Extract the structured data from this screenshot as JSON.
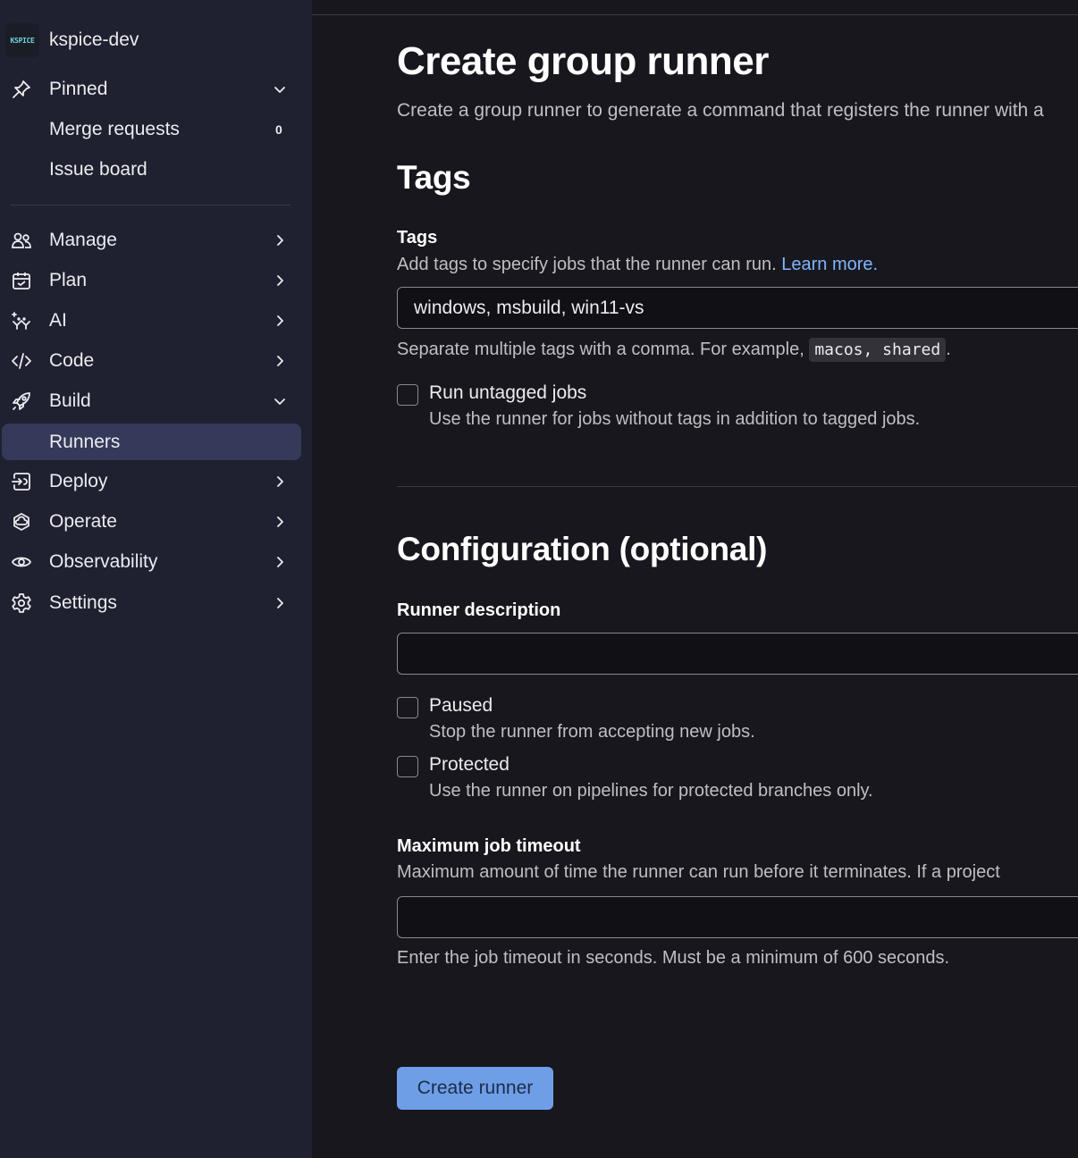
{
  "sidebar": {
    "group": {
      "avatar_text": "KSPICE",
      "name": "kspice-dev"
    },
    "pinned": {
      "label": "Pinned",
      "items": [
        {
          "label": "Merge requests",
          "count": "0"
        },
        {
          "label": "Issue board"
        }
      ]
    },
    "nav": [
      {
        "label": "Manage",
        "icon": "users-icon"
      },
      {
        "label": "Plan",
        "icon": "calendar-icon"
      },
      {
        "label": "AI",
        "icon": "sparkle-icon"
      },
      {
        "label": "Code",
        "icon": "code-icon"
      },
      {
        "label": "Build",
        "icon": "rocket-icon",
        "expanded": true,
        "children": [
          {
            "label": "Runners",
            "active": true
          }
        ]
      },
      {
        "label": "Deploy",
        "icon": "deploy-icon"
      },
      {
        "label": "Operate",
        "icon": "cloud-icon"
      },
      {
        "label": "Observability",
        "icon": "eye-icon"
      },
      {
        "label": "Settings",
        "icon": "gear-icon"
      }
    ]
  },
  "main": {
    "title": "Create group runner",
    "lead": "Create a group runner to generate a command that registers the runner with a",
    "tags_section": {
      "heading": "Tags",
      "label": "Tags",
      "description": "Add tags to specify jobs that the runner can run.",
      "learn_more": "Learn more.",
      "value": "windows, msbuild, win11-vs",
      "help_prefix": "Separate multiple tags with a comma. For example,",
      "help_code": "macos, shared",
      "help_suffix": ".",
      "untagged": {
        "label": "Run untagged jobs",
        "help": "Use the runner for jobs without tags in addition to tagged jobs.",
        "checked": false
      }
    },
    "config_section": {
      "heading": "Configuration (optional)",
      "description_label": "Runner description",
      "description_value": "",
      "paused": {
        "label": "Paused",
        "help": "Stop the runner from accepting new jobs.",
        "checked": false
      },
      "protected": {
        "label": "Protected",
        "help": "Use the runner on pipelines for protected branches only.",
        "checked": false
      },
      "timeout_label": "Maximum job timeout",
      "timeout_description": "Maximum amount of time the runner can run before it terminates. If a project",
      "timeout_value": "",
      "timeout_help": "Enter the job timeout in seconds. Must be a minimum of 600 seconds."
    },
    "submit_label": "Create runner"
  },
  "colors": {
    "sidebar_bg": "#1f2130",
    "main_bg": "#18171d",
    "active_item": "#35395a",
    "link": "#7fb6ff",
    "primary_button": "#6e9fe6"
  }
}
